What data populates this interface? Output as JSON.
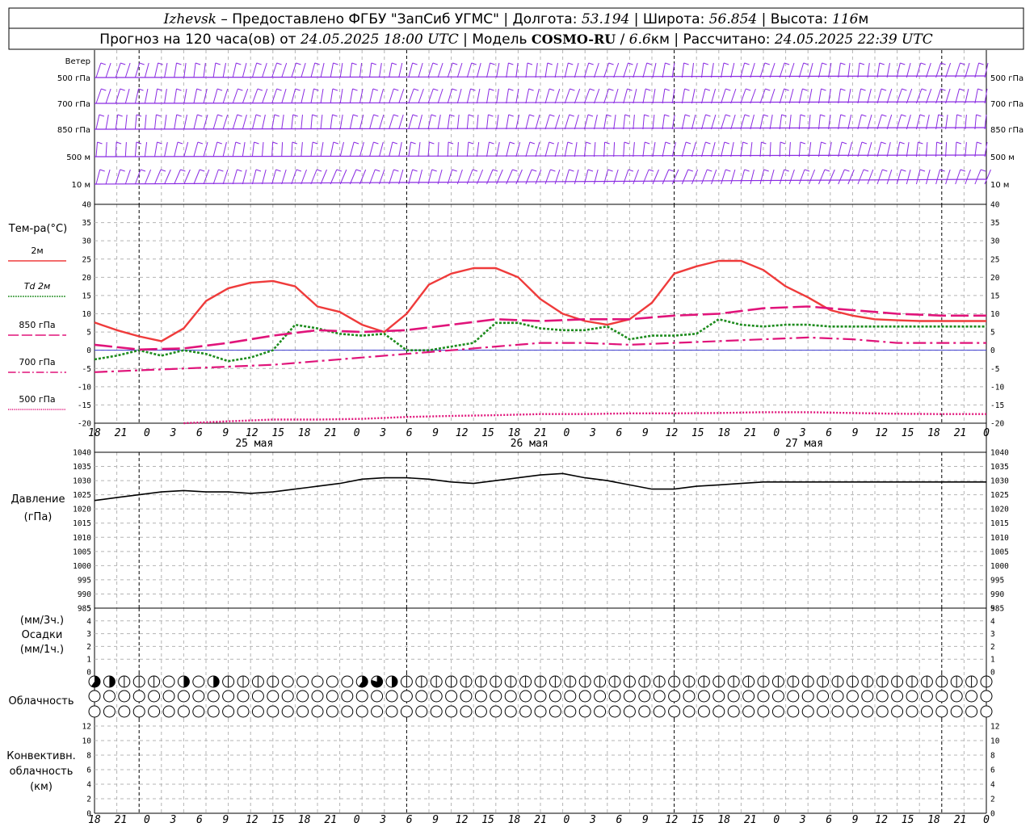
{
  "header": {
    "line1": [
      {
        "text": "Izhevsk",
        "style": "i"
      },
      {
        "text": " – Предоставлено ФГБУ \"ЗапСиб УГМС\" | Долгота: ",
        "style": "n"
      },
      {
        "text": "53.194",
        "style": "i"
      },
      {
        "text": " | Широта: ",
        "style": "n"
      },
      {
        "text": "56.854",
        "style": "i"
      },
      {
        "text": " | Высота: ",
        "style": "n"
      },
      {
        "text": "116",
        "style": "i"
      },
      {
        "text": "м",
        "style": "n"
      }
    ],
    "line2": [
      {
        "text": "Прогноз на 120 часа(ов) от ",
        "style": "n"
      },
      {
        "text": "24.05.2025 18:00 UTC",
        "style": "i"
      },
      {
        "text": "  | Модель ",
        "style": "n"
      },
      {
        "text": "COSMO-RU",
        "style": "b"
      },
      {
        "text": " / ",
        "style": "n"
      },
      {
        "text": "6.6",
        "style": "i"
      },
      {
        "text": "км | Рассчитано: ",
        "style": "n"
      },
      {
        "text": "24.05.2025 22:39 UTC",
        "style": "i"
      }
    ]
  },
  "wind_panel": {
    "levels": [
      "Ветер",
      "500 гПа",
      "700 гПа",
      "850 гПа",
      "500 м",
      "10 м"
    ],
    "right_levels": [
      "500 гПа",
      "700 гПа",
      "850 гПа",
      "500 м",
      "10 м"
    ],
    "color": "#8a2be2"
  },
  "temp_panel": {
    "title": "Тем-ра(°C)",
    "legend": [
      {
        "label": "2м",
        "color": "#ef3b3b",
        "dash": "solid"
      },
      {
        "label": "Td 2м",
        "color": "#1e8c1e",
        "dash": "dotted"
      },
      {
        "label": "850 гПа",
        "color": "#e0147a",
        "dash": "long"
      },
      {
        "label": "700 гПа",
        "color": "#e0147a",
        "dash": "dashdot"
      },
      {
        "label": "500 гПа",
        "color": "#e0147a",
        "dash": "fine"
      }
    ]
  },
  "pressure_panel": {
    "label1": "Давление",
    "label2": "(гПа)"
  },
  "precip_panel": {
    "label1": "(мм/3ч.)",
    "label2": "Осадки",
    "label3": "(мм/1ч.)"
  },
  "cloud_panel": {
    "label": "Облачность"
  },
  "conv_panel": {
    "label1": "Конвективн.",
    "label2": "облачность",
    "label3": "(км)"
  },
  "chart_data": [
    {
      "type": "line",
      "panel": "temperature",
      "x_hours": [
        0,
        3,
        6,
        9,
        12,
        15,
        18,
        21,
        24,
        27,
        30,
        33,
        36,
        39,
        42,
        45,
        48,
        51,
        54,
        57,
        60,
        63,
        66,
        69,
        72,
        75,
        78,
        81,
        84,
        87,
        90,
        93,
        96,
        99,
        102,
        105,
        108,
        111,
        114,
        117
      ],
      "x_tick_labels": [
        "18",
        "21",
        "0",
        "3",
        "6",
        "9",
        "12",
        "15",
        "18",
        "21",
        "0",
        "3",
        "6",
        "9",
        "12",
        "15",
        "18",
        "21",
        "0",
        "3",
        "6",
        "9",
        "12",
        "15",
        "18",
        "21",
        "0",
        "3",
        "6",
        "9",
        "12",
        "15",
        "18",
        "21",
        "0"
      ],
      "date_labels": [
        "25 мая",
        "26 мая",
        "27 мая"
      ],
      "ylim": [
        -20,
        40
      ],
      "y_ticks": [
        -20,
        -15,
        -10,
        -5,
        0,
        5,
        10,
        15,
        20,
        25,
        30,
        35,
        40
      ],
      "series": [
        {
          "name": "2м",
          "hours": [
            0,
            3,
            6,
            9,
            12,
            15,
            18,
            21,
            24,
            27,
            30,
            33,
            36,
            39,
            42,
            45,
            48,
            51,
            54,
            57,
            60,
            63,
            66,
            69,
            72,
            75,
            78,
            81,
            84,
            87,
            90,
            93,
            96,
            99,
            102,
            105,
            108,
            111,
            114,
            117,
            120
          ],
          "values": [
            7.6,
            5.5,
            3.8,
            2.5,
            6,
            13.5,
            17,
            18.5,
            19,
            17.5,
            12,
            10.5,
            7,
            5,
            10,
            18,
            21,
            22.5,
            22.5,
            20,
            14,
            10,
            8,
            7,
            8.5,
            13,
            21,
            23,
            24.5,
            24.5,
            22,
            17.5,
            14.5,
            11,
            9.5,
            8.5,
            8.2,
            8,
            8,
            8,
            8
          ]
        },
        {
          "name": "Td 2м",
          "hours": [
            0,
            3,
            6,
            9,
            12,
            15,
            18,
            21,
            24,
            27,
            30,
            33,
            36,
            39,
            42,
            45,
            48,
            51,
            54,
            57,
            60,
            63,
            66,
            69,
            72,
            75,
            78,
            81,
            84,
            87,
            90,
            93,
            96,
            99,
            102,
            105,
            108,
            111,
            114,
            117,
            120
          ],
          "values": [
            -2.5,
            -1.5,
            0,
            -1.5,
            0,
            -1,
            -3,
            -2,
            0,
            7,
            6,
            4.5,
            4,
            4.5,
            0,
            0,
            1,
            2,
            7.5,
            7.5,
            6,
            5.5,
            5.5,
            6.5,
            3,
            4,
            4,
            4.5,
            8.5,
            7,
            6.5,
            7,
            7,
            6.5,
            6.5,
            6.5,
            6.5,
            6.5,
            6.5,
            6.5,
            6.5
          ]
        },
        {
          "name": "850 гПа",
          "hours": [
            0,
            6,
            12,
            18,
            24,
            30,
            36,
            42,
            48,
            54,
            60,
            66,
            72,
            78,
            84,
            90,
            96,
            102,
            108,
            114,
            120
          ],
          "values": [
            1.5,
            0.2,
            0.5,
            2,
            4,
            5.5,
            5,
            5.5,
            7,
            8.5,
            8,
            8.5,
            8.5,
            9.5,
            10,
            11.5,
            12,
            11,
            10,
            9.5,
            9.5
          ]
        },
        {
          "name": "700 гПа",
          "hours": [
            0,
            6,
            12,
            18,
            24,
            30,
            36,
            42,
            48,
            54,
            60,
            66,
            72,
            78,
            84,
            90,
            96,
            102,
            108,
            114,
            120
          ],
          "values": [
            -6,
            -5.5,
            -5,
            -4.5,
            -4,
            -3,
            -2,
            -1,
            0,
            1,
            2,
            2,
            1.5,
            2,
            2.5,
            3,
            3.5,
            3,
            2,
            2,
            2
          ]
        },
        {
          "name": "500 гПа",
          "hours": [
            12,
            18,
            24,
            30,
            36,
            42,
            48,
            54,
            60,
            66,
            72,
            78,
            84,
            90,
            96,
            102,
            108,
            114,
            120
          ],
          "values": [
            -20,
            -19.5,
            -19,
            -19,
            -18.8,
            -18.3,
            -18,
            -17.8,
            -17.5,
            -17.5,
            -17.3,
            -17.3,
            -17.2,
            -17,
            -17,
            -17.2,
            -17.4,
            -17.5,
            -17.5
          ]
        }
      ]
    },
    {
      "type": "line",
      "panel": "pressure",
      "ylabel": "гПа",
      "ylim": [
        985,
        1040
      ],
      "y_ticks": [
        985,
        990,
        995,
        1000,
        1005,
        1010,
        1015,
        1020,
        1025,
        1030,
        1035,
        1040
      ],
      "series": [
        {
          "hours": [
            0,
            3,
            6,
            9,
            12,
            15,
            18,
            21,
            24,
            27,
            30,
            33,
            36,
            39,
            42,
            45,
            48,
            51,
            54,
            57,
            60,
            63,
            66,
            69,
            72,
            75,
            78,
            81,
            84,
            87,
            90,
            93,
            96,
            99,
            102,
            105,
            108,
            111,
            114,
            117,
            120
          ],
          "values": [
            1023,
            1024,
            1025,
            1026,
            1026.5,
            1026,
            1026,
            1025.5,
            1026,
            1027,
            1028,
            1029,
            1030.5,
            1031,
            1031,
            1030.5,
            1029.5,
            1029,
            1030,
            1031,
            1032,
            1032.5,
            1031,
            1030,
            1028.5,
            1027,
            1027,
            1028,
            1028.5,
            1029,
            1029.5,
            1029.5,
            1029.5,
            1029.5,
            1029.5,
            1029.5,
            1029.5,
            1029.5,
            1029.5,
            1029.5,
            1029.5
          ]
        }
      ]
    },
    {
      "type": "bar",
      "panel": "precipitation",
      "ylim": [
        0,
        5
      ],
      "y_ticks": [
        0,
        1,
        2,
        3,
        4,
        5
      ],
      "series": []
    },
    {
      "type": "table",
      "panel": "cloudiness",
      "rows": 3,
      "cells_per_row": 61,
      "cover_top_row": {
        "0": 0.6,
        "1": 0.5,
        "2": 0.2,
        "3": 0.2,
        "4": 0.2,
        "5": 0.1,
        "6": 0.5,
        "7": 0.1,
        "8": 0.5,
        "9": 0.3,
        "10": 0.2,
        "11": 0.2,
        "12": 0.2,
        "13": 0.1,
        "14": 0.1,
        "15": 0.1,
        "16": 0.1,
        "17": 0.1,
        "18": 0.6,
        "19": 0.8,
        "20": 0.5,
        "21": 0.2,
        "22": 0.2,
        "23": 0.2,
        "24": 0.2,
        "25": 0.2,
        "26": 0.2,
        "27": 0.2,
        "28": 0.2,
        "29": 0.2,
        "30": 0.2,
        "31": 0.2,
        "32": 0.2,
        "33": 0.2,
        "34": 0.2,
        "35": 0.2,
        "36": 0.2,
        "37": 0.2,
        "38": 0.2,
        "39": 0.2,
        "40": 0.2,
        "41": 0.2,
        "42": 0.2,
        "43": 0.2,
        "44": 0.2,
        "45": 0.2,
        "46": 0.2,
        "47": 0.2,
        "48": 0.2,
        "49": 0.2,
        "50": 0.2,
        "51": 0.2,
        "52": 0.2,
        "53": 0.2,
        "54": 0.2,
        "55": 0.2,
        "56": 0.2,
        "57": 0.2,
        "58": 0.2,
        "59": 0.2,
        "60": 0.2
      }
    },
    {
      "type": "bar",
      "panel": "convective_cloud",
      "ylim": [
        0,
        13
      ],
      "y_ticks": [
        0,
        2,
        4,
        6,
        8,
        10,
        12
      ],
      "series": []
    }
  ]
}
